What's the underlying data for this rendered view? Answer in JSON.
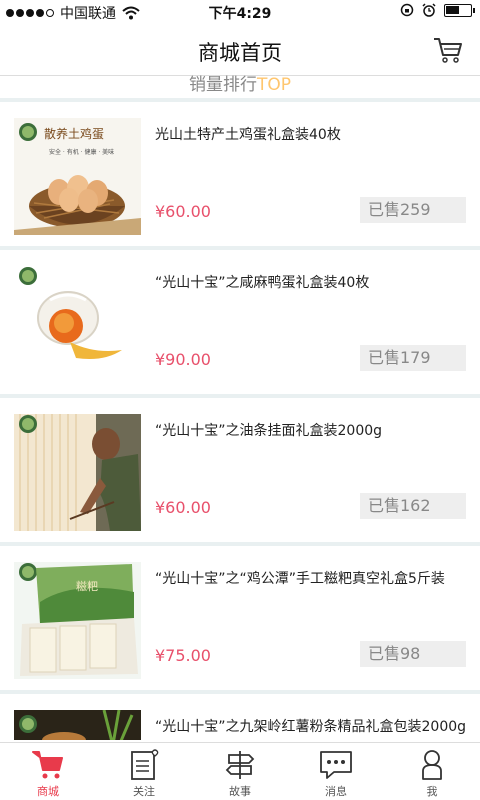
{
  "status_bar": {
    "carrier": "中国联通",
    "time": "下午4:29"
  },
  "header": {
    "title": "商城首页",
    "cart_icon": "cart-icon"
  },
  "section": {
    "title_text": "销量排行",
    "title_accent": "TOP"
  },
  "products": [
    {
      "name": "光山土特产土鸡蛋礼盒装40枚",
      "price": "¥60.00",
      "sold": "已售259",
      "thumb_text": "散养土鸡蛋",
      "thumb_sub": "安全 · 有机 · 健康 · 美味"
    },
    {
      "name": "“光山十宝”之咸麻鸭蛋礼盒装40枚",
      "price": "¥90.00",
      "sold": "已售179"
    },
    {
      "name": "“光山十宝”之油条挂面礼盒装2000g",
      "price": "¥60.00",
      "sold": "已售162"
    },
    {
      "name": "“光山十宝”之“鸡公潭”手工糍粑真空礼盒5斤装",
      "price": "¥75.00",
      "sold": "已售98",
      "thumb_text": "糍粑"
    },
    {
      "name": "“光山十宝”之九架岭红薯粉条精品礼盒包装2000g",
      "price": "",
      "sold": ""
    }
  ],
  "tabs": [
    {
      "label": "商城",
      "icon": "cart-icon",
      "active": true
    },
    {
      "label": "关注",
      "icon": "heart-document-icon",
      "active": false
    },
    {
      "label": "故事",
      "icon": "signpost-icon",
      "active": false
    },
    {
      "label": "消息",
      "icon": "chat-bubble-icon",
      "active": false
    },
    {
      "label": "我",
      "icon": "person-icon",
      "active": false
    }
  ],
  "colors": {
    "accent": "#e83a4b",
    "price": "#e8506b",
    "section_top": "#ffc66e",
    "band": "#e9f0f1"
  }
}
